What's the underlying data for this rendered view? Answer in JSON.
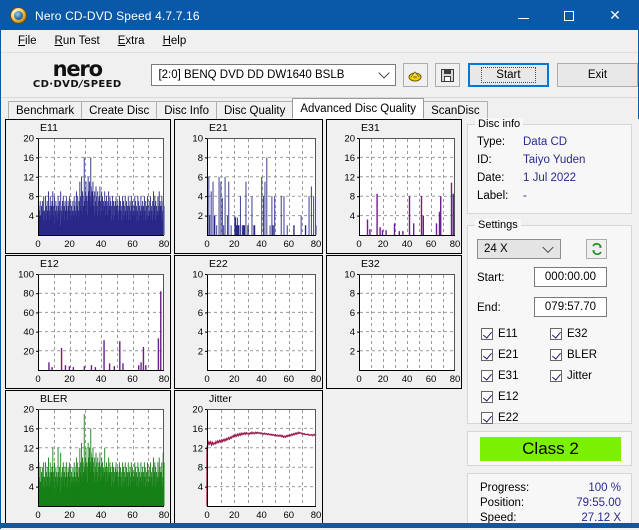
{
  "window": {
    "title": "Nero CD-DVD Speed 4.7.7.16",
    "icon": "nero-app-icon",
    "minimize_label": "minimize",
    "maximize_label": "maximize",
    "close_label": "✕"
  },
  "menubar": {
    "items": [
      {
        "label": "File",
        "accel": "F"
      },
      {
        "label": "Run Test",
        "accel": "R"
      },
      {
        "label": "Extra",
        "accel": "E"
      },
      {
        "label": "Help",
        "accel": "H"
      }
    ]
  },
  "toolbar": {
    "logo_word": "nero",
    "logo_sub_left": "CD·DVD",
    "logo_sub_slash": "∕",
    "logo_sub_right": "SPEED",
    "drive_selected": "[2:0]   BENQ DVD DD DW1640 BSLB",
    "drive_icon": "disc-eject-icon",
    "save_icon": "save-floppy-icon",
    "start_label": "Start",
    "exit_label": "Exit"
  },
  "tabs": [
    {
      "label": "Benchmark",
      "active": false
    },
    {
      "label": "Create Disc",
      "active": false
    },
    {
      "label": "Disc Info",
      "active": false
    },
    {
      "label": "Disc Quality",
      "active": false
    },
    {
      "label": "Advanced Disc Quality",
      "active": true
    },
    {
      "label": "ScanDisc",
      "active": false
    }
  ],
  "disc_info": {
    "group_label": "Disc info",
    "type_key": "Type:",
    "type_value": "Data CD",
    "id_key": "ID:",
    "id_value": "Taiyo Yuden",
    "date_key": "Date:",
    "date_value": "1 Jul 2022",
    "label_key": "Label:",
    "label_value": "-"
  },
  "settings": {
    "group_label": "Settings",
    "speed_selected": "24 X",
    "refresh_icon": "refresh-green-icon",
    "start_key": "Start:",
    "start_value": "000:00.00",
    "end_key": "End:",
    "end_value": "079:57.70",
    "checkboxes_left": [
      {
        "label": "E11",
        "checked": true
      },
      {
        "label": "E21",
        "checked": true
      },
      {
        "label": "E31",
        "checked": true
      },
      {
        "label": "E12",
        "checked": true
      },
      {
        "label": "E22",
        "checked": true
      }
    ],
    "checkboxes_right": [
      {
        "label": "E32",
        "checked": true
      },
      {
        "label": "BLER",
        "checked": true
      },
      {
        "label": "Jitter",
        "checked": true
      }
    ]
  },
  "result": {
    "class_label": "Class 2",
    "class_color": "#7cf003",
    "progress_key": "Progress:",
    "progress_value": "100 %",
    "position_key": "Position:",
    "position_value": "79:55.00",
    "speed_key": "Speed:",
    "speed_value": "27.12 X"
  },
  "chart_data": [
    {
      "id": "e11",
      "type": "bar",
      "title": "E11",
      "color": "#282888",
      "xlabel": "",
      "ylabel": "",
      "xlim": [
        0,
        80
      ],
      "ylim": [
        0,
        20
      ],
      "xticks": [
        0,
        20,
        40,
        60,
        80
      ],
      "yticks": [
        4,
        8,
        12,
        16,
        20
      ],
      "grid": true,
      "values": [
        9.5,
        6,
        5,
        4,
        7,
        4,
        3,
        6,
        4,
        7,
        5,
        3,
        8,
        5,
        2,
        5,
        8,
        4,
        6,
        3,
        7,
        5,
        4,
        9,
        6,
        3,
        5,
        8,
        4,
        6,
        3,
        7,
        5,
        9,
        4,
        6,
        2,
        8,
        5,
        3,
        7,
        4,
        6,
        5,
        3,
        8,
        6,
        4,
        7,
        5,
        2,
        9,
        6,
        3,
        5,
        7,
        4,
        8,
        5,
        6,
        3,
        7,
        4,
        5,
        8,
        6,
        3,
        5,
        7,
        4,
        6,
        8,
        5,
        3,
        7,
        4,
        6,
        5,
        3,
        7,
        5,
        4,
        8,
        6,
        3,
        5,
        7,
        9,
        4,
        6,
        8,
        5,
        3,
        7,
        4,
        11,
        6,
        8,
        5,
        12,
        7,
        9,
        4,
        6,
        8,
        16,
        7,
        5,
        9,
        11,
        6,
        8,
        4,
        7,
        12,
        9,
        5,
        11,
        8,
        6,
        16,
        10,
        7,
        9,
        5,
        11,
        8,
        6,
        4,
        9,
        7,
        5,
        10,
        8,
        6,
        4,
        9,
        7,
        5,
        8,
        6,
        10,
        4,
        7,
        5,
        9,
        6,
        8,
        4,
        7,
        5,
        6,
        9,
        4,
        7,
        5,
        8,
        6,
        4,
        7,
        5,
        9,
        6,
        4,
        8,
        5,
        7,
        3,
        6,
        4,
        8,
        5,
        7,
        3,
        6,
        4,
        7,
        5,
        8,
        3,
        6,
        4,
        7,
        5,
        3,
        6,
        8,
        4,
        7,
        5,
        3,
        6,
        4,
        8,
        5,
        7,
        3,
        6,
        4,
        8,
        5,
        3,
        7,
        4,
        6,
        5,
        8,
        3,
        6,
        4,
        7,
        5,
        3,
        8,
        6,
        4,
        7,
        5,
        3,
        6,
        4,
        8,
        5,
        7,
        3,
        6,
        4,
        5,
        8,
        3,
        7,
        4,
        6,
        5,
        3,
        8,
        4,
        6,
        5,
        7,
        3,
        6,
        4,
        8,
        5,
        3,
        7,
        4,
        6,
        5,
        8,
        3,
        4,
        6,
        7,
        5,
        3,
        8,
        4,
        6,
        5,
        3,
        7,
        4,
        9,
        6,
        5,
        8,
        3,
        7,
        4,
        6,
        5,
        3,
        8,
        4,
        6,
        9,
        5,
        7,
        3,
        6,
        4,
        8,
        5,
        3,
        7,
        4,
        6
      ]
    },
    {
      "id": "e21",
      "type": "bar",
      "title": "E21",
      "color": "#282888",
      "xlim": [
        0,
        80
      ],
      "ylim": [
        0,
        10
      ],
      "xticks": [
        0,
        20,
        40,
        60,
        80
      ],
      "yticks": [
        2,
        4,
        6,
        8,
        10
      ],
      "grid": true,
      "values": [
        8,
        0,
        0,
        6,
        0,
        2,
        0,
        0,
        4.5,
        0,
        0,
        0,
        5.5,
        0,
        0,
        2,
        2,
        0,
        0,
        0,
        1,
        0,
        0,
        0,
        0,
        6,
        0,
        0,
        0,
        5.5,
        0,
        0,
        3.8,
        0,
        0,
        1,
        0,
        0,
        6,
        0,
        0,
        0,
        0,
        2,
        0,
        0,
        5.5,
        0,
        0,
        0,
        0,
        1,
        0,
        0,
        0,
        0,
        0,
        0,
        0,
        2,
        1.8,
        1.8,
        1,
        1,
        1,
        1.8,
        1,
        1,
        1,
        0,
        0,
        4,
        0,
        0,
        0,
        1,
        0,
        1,
        1,
        1,
        1,
        0,
        0,
        5.5,
        0,
        0,
        0,
        1,
        1,
        0,
        0,
        0,
        0,
        0,
        0,
        0,
        4,
        0,
        0,
        0,
        1,
        1,
        1,
        0,
        0,
        0,
        0,
        0,
        0,
        0,
        0,
        0,
        0,
        0,
        0,
        0,
        0,
        6,
        0,
        0,
        0,
        4,
        0,
        0,
        5.5,
        0,
        0,
        0,
        8,
        0,
        0,
        0,
        0,
        0,
        0,
        1,
        0,
        0,
        0,
        4,
        0,
        1,
        1,
        0,
        0,
        4,
        0,
        0,
        0,
        0,
        0,
        0,
        0,
        0,
        0,
        0,
        0,
        0,
        0,
        4,
        0,
        0,
        0,
        0,
        0,
        4,
        0,
        0,
        0,
        0,
        0,
        0,
        1,
        0,
        0,
        0,
        0,
        0,
        0,
        0,
        0,
        0,
        0,
        0,
        0,
        0,
        1,
        1,
        0,
        0,
        0,
        0,
        0,
        0,
        0,
        0,
        0,
        0,
        0,
        0,
        0,
        0,
        2,
        0,
        0,
        0,
        0,
        0,
        0,
        0,
        0,
        1,
        1,
        0,
        0,
        0,
        0,
        0,
        0,
        4,
        0,
        0,
        0,
        0,
        5,
        0,
        0,
        0,
        0,
        4,
        0,
        0,
        0,
        1,
        1
      ]
    },
    {
      "id": "e31",
      "type": "bar",
      "title": "E31",
      "color": "#6b1f8c",
      "xlim": [
        0,
        80
      ],
      "ylim": [
        0,
        20
      ],
      "xticks": [
        0,
        20,
        40,
        60,
        80
      ],
      "yticks": [
        4,
        8,
        12,
        16,
        20
      ],
      "grid": true,
      "spikes": [
        {
          "x": 6.5,
          "y": 3.2
        },
        {
          "x": 8.5,
          "y": 1.2
        },
        {
          "x": 14.5,
          "y": 8.5
        },
        {
          "x": 17,
          "y": 1.6
        },
        {
          "x": 19,
          "y": 1.0
        },
        {
          "x": 22,
          "y": 1.0
        },
        {
          "x": 29,
          "y": 2.4
        },
        {
          "x": 33,
          "y": 0.8
        },
        {
          "x": 36,
          "y": 0.8
        },
        {
          "x": 41.5,
          "y": 8.0
        },
        {
          "x": 45,
          "y": 2.4
        },
        {
          "x": 51.5,
          "y": 8.0
        },
        {
          "x": 53,
          "y": 4.0
        },
        {
          "x": 64,
          "y": 2.4
        },
        {
          "x": 66.5,
          "y": 4.8
        },
        {
          "x": 67.5,
          "y": 8.0
        },
        {
          "x": 76.5,
          "y": 10.8
        },
        {
          "x": 78,
          "y": 8.5
        }
      ]
    },
    {
      "id": "e12",
      "type": "bar",
      "title": "E12",
      "color": "#6b1f8c",
      "xlim": [
        0,
        80
      ],
      "ylim": [
        0,
        100
      ],
      "xticks": [
        0,
        20,
        40,
        60,
        80
      ],
      "yticks": [
        20,
        40,
        60,
        80,
        100
      ],
      "grid": true,
      "spikes": [
        {
          "x": 6.5,
          "y": 8
        },
        {
          "x": 8.5,
          "y": 3
        },
        {
          "x": 14.5,
          "y": 23
        },
        {
          "x": 17,
          "y": 5
        },
        {
          "x": 19.5,
          "y": 4
        },
        {
          "x": 22,
          "y": 3
        },
        {
          "x": 29,
          "y": 4
        },
        {
          "x": 33.5,
          "y": 5
        },
        {
          "x": 36,
          "y": 3
        },
        {
          "x": 41.5,
          "y": 31
        },
        {
          "x": 45,
          "y": 7
        },
        {
          "x": 48,
          "y": 4
        },
        {
          "x": 51.5,
          "y": 30
        },
        {
          "x": 53.5,
          "y": 7
        },
        {
          "x": 63.5,
          "y": 5
        },
        {
          "x": 65,
          "y": 8
        },
        {
          "x": 66.5,
          "y": 24
        },
        {
          "x": 68,
          "y": 5
        },
        {
          "x": 76,
          "y": 33
        },
        {
          "x": 77.5,
          "y": 82
        }
      ]
    },
    {
      "id": "e22",
      "type": "bar",
      "title": "E22",
      "color": "#282888",
      "xlim": [
        0,
        80
      ],
      "ylim": [
        0,
        10
      ],
      "xticks": [
        0,
        20,
        40,
        60,
        80
      ],
      "yticks": [
        2,
        4,
        6,
        8,
        10
      ],
      "grid": true,
      "values": []
    },
    {
      "id": "e32",
      "type": "bar",
      "title": "E32",
      "color": "#282888",
      "xlim": [
        0,
        80
      ],
      "ylim": [
        0,
        10
      ],
      "xticks": [
        0,
        20,
        40,
        60,
        80
      ],
      "yticks": [
        2,
        4,
        6,
        8,
        10
      ],
      "grid": true,
      "values": []
    },
    {
      "id": "bler",
      "type": "bar",
      "title": "BLER",
      "color": "#168016",
      "xlim": [
        0,
        80
      ],
      "ylim": [
        0,
        20
      ],
      "xticks": [
        0,
        20,
        40,
        60,
        80
      ],
      "yticks": [
        4,
        8,
        12,
        16,
        20
      ],
      "grid": true,
      "values": [
        18,
        9,
        6,
        5,
        8,
        5,
        4,
        7,
        5,
        8,
        6,
        4,
        9,
        6,
        3,
        6,
        9,
        5,
        7,
        4,
        8,
        6,
        5,
        10,
        7,
        4,
        6,
        9,
        5,
        7,
        4,
        8,
        6,
        12,
        5,
        7,
        3,
        9,
        6,
        4,
        8,
        5,
        7,
        6,
        4,
        12,
        7,
        5,
        8,
        6,
        3,
        11,
        7,
        4,
        6,
        8,
        5,
        9,
        6,
        7,
        4,
        8,
        5,
        6,
        9,
        7,
        4,
        6,
        8,
        5,
        7,
        9,
        6,
        4,
        8,
        5,
        7,
        6,
        4,
        8,
        6,
        5,
        9,
        7,
        4,
        6,
        8,
        10,
        5,
        7,
        9,
        6,
        4,
        8,
        5,
        12,
        7,
        9,
        6,
        13,
        8,
        10,
        5,
        7,
        9,
        19,
        8,
        6,
        10,
        12,
        7,
        9,
        5,
        8,
        13,
        10,
        6,
        12,
        9,
        7,
        16,
        11,
        8,
        10,
        6,
        12,
        9,
        7,
        5,
        10,
        8,
        6,
        11,
        9,
        7,
        5,
        10,
        8,
        6,
        9,
        7,
        11,
        5,
        8,
        6,
        10,
        7,
        9,
        5,
        8,
        6,
        7,
        12,
        5,
        8,
        6,
        9,
        7,
        5,
        8,
        6,
        10,
        7,
        5,
        9,
        6,
        8,
        4,
        7,
        5,
        9,
        6,
        8,
        4,
        7,
        5,
        8,
        6,
        9,
        4,
        7,
        5,
        8,
        6,
        4,
        7,
        9,
        5,
        8,
        6,
        4,
        7,
        5,
        9,
        6,
        8,
        4,
        7,
        5,
        9,
        6,
        4,
        8,
        5,
        7,
        6,
        9,
        4,
        7,
        5,
        8,
        6,
        4,
        9,
        7,
        5,
        8,
        6,
        4,
        7,
        5,
        9,
        6,
        8,
        4,
        7,
        5,
        6,
        9,
        4,
        8,
        5,
        7,
        6,
        4,
        9,
        5,
        7,
        6,
        8,
        4,
        7,
        5,
        9,
        6,
        4,
        8,
        5,
        7,
        6,
        9,
        4,
        5,
        7,
        8,
        6,
        4,
        9,
        5,
        7,
        6,
        4,
        8,
        5,
        10,
        7,
        6,
        9,
        4,
        8,
        5,
        7,
        6,
        4,
        9,
        5,
        7,
        10,
        6,
        8,
        4,
        7,
        5,
        9,
        6,
        4,
        11,
        5,
        9
      ]
    },
    {
      "id": "jitter",
      "type": "line",
      "title": "Jitter",
      "color": "#9c1f50",
      "xlim": [
        0,
        80
      ],
      "ylim": [
        0,
        20
      ],
      "xticks": [
        0,
        20,
        40,
        60,
        80
      ],
      "yticks": [
        4,
        8,
        12,
        16,
        20
      ],
      "grid": true,
      "values": [
        12.1,
        12.6,
        13.2,
        12.8,
        13.2,
        12.6,
        13.1,
        12.7,
        13.0,
        12.8,
        13.3,
        13.0,
        13.4,
        13.1,
        13.5,
        13.2,
        13.6,
        13.3,
        13.7,
        13.4,
        13.8,
        13.5,
        13.9,
        13.7,
        14.1,
        13.8,
        14.2,
        14.0,
        14.4,
        14.2,
        14.6,
        14.3,
        14.7,
        14.4,
        14.8,
        14.5,
        14.9,
        14.6,
        15.0,
        14.7,
        15.0,
        14.8,
        15.1,
        14.8,
        15.1,
        14.9,
        15.0,
        14.8,
        15.1,
        14.9,
        15.2,
        14.9,
        15.1,
        14.9,
        15.2,
        15.0,
        15.2,
        15.0,
        15.1,
        14.9,
        15.1,
        14.9,
        15.0,
        14.8,
        15.0,
        14.8,
        14.9,
        14.7,
        14.9,
        14.7,
        14.8,
        14.6,
        14.8,
        14.6,
        14.7,
        14.5,
        14.7,
        14.5,
        14.6,
        14.4,
        14.6,
        14.4,
        14.6,
        14.3,
        14.5,
        14.2,
        14.4,
        14.2,
        14.5,
        14.3,
        14.6,
        14.4,
        14.7,
        14.5,
        14.8,
        14.6,
        14.9,
        14.7,
        15.0,
        14.8,
        15.1,
        14.9,
        15.2,
        15.0,
        15.1,
        14.9,
        15.0,
        14.8,
        14.9,
        14.7,
        14.8,
        14.7,
        14.8,
        14.6,
        14.7,
        14.6,
        14.7,
        14.5,
        14.7,
        14.6,
        14.8,
        14.6
      ]
    }
  ]
}
